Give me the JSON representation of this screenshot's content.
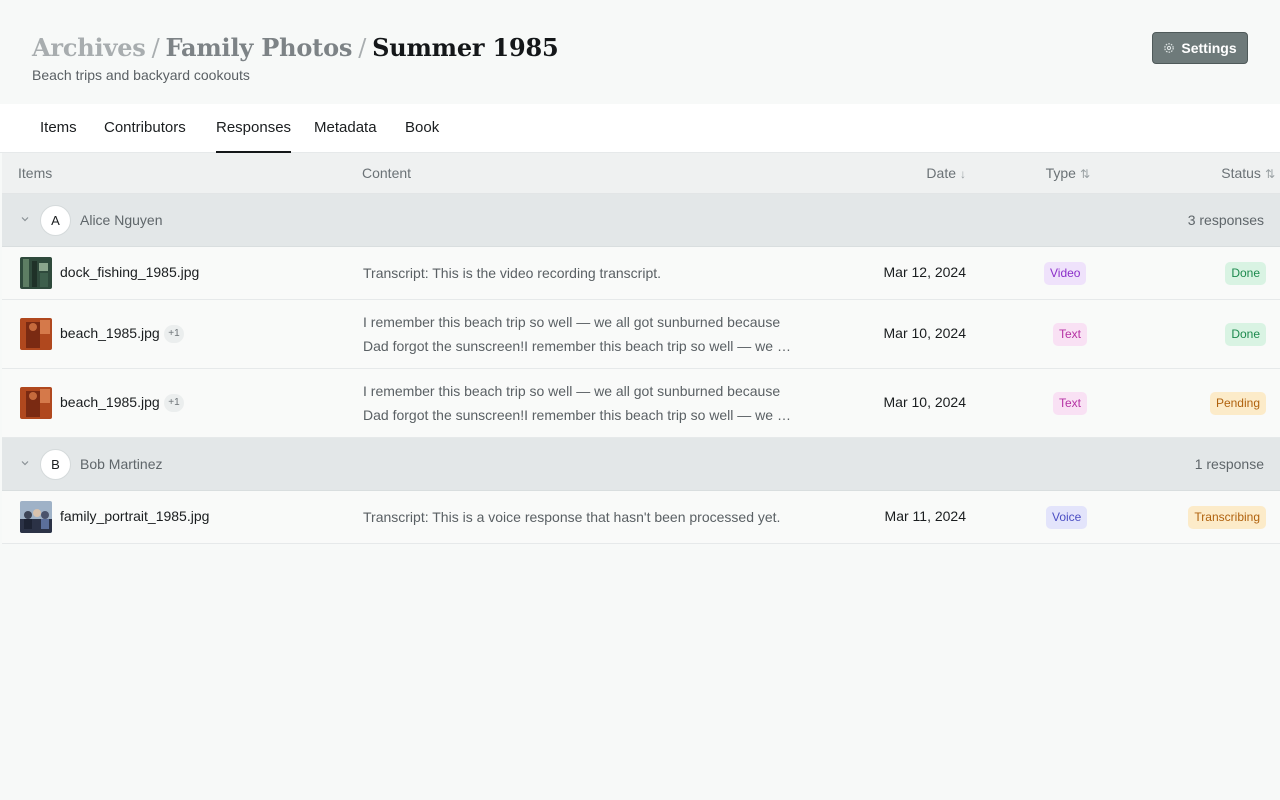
{
  "header": {
    "breadcrumb": [
      "Archives",
      "Family Photos",
      "Summer 1985"
    ],
    "separator": "/",
    "subtitle": "Beach trips and backyard cookouts",
    "settings_label": "Settings",
    "settings_icon": "gear-icon"
  },
  "tabs": [
    {
      "label": "Items"
    },
    {
      "label": "Contributors"
    },
    {
      "label": "Responses",
      "active": true
    },
    {
      "label": "Metadata"
    },
    {
      "label": "Book"
    }
  ],
  "table": {
    "columns": {
      "items": "Items",
      "content": "Content",
      "date": "Date",
      "date_sort": "↓",
      "type": "Type",
      "type_sort": "⇅",
      "status": "Status",
      "status_sort": "⇅"
    },
    "groups": [
      {
        "initial": "A",
        "name": "Alice Nguyen",
        "count": "3 responses",
        "rows": [
          {
            "file": "dock_fishing_1985.jpg",
            "extra": "",
            "content": [
              "Transcript: This is the video recording transcript."
            ],
            "date": "Mar 12, 2024",
            "type": "Video",
            "status": "Done"
          },
          {
            "file": "beach_1985.jpg",
            "extra": "+1",
            "content": [
              "I remember this beach trip so well — we all got sunburned because",
              "Dad forgot the sunscreen!I remember this beach trip so well — we all got sunburned"
            ],
            "date": "Mar 10, 2024",
            "type": "Text",
            "status": "Done"
          },
          {
            "file": "beach_1985.jpg",
            "extra": "+1",
            "content": [
              "I remember this beach trip so well — we all got sunburned because",
              "Dad forgot the sunscreen!I remember this beach trip so well — we all got sunburned"
            ],
            "date": "Mar 10, 2024",
            "type": "Text",
            "status": "Pending"
          }
        ]
      },
      {
        "initial": "B",
        "name": "Bob Martinez",
        "count": "1 response",
        "rows": [
          {
            "file": "family_portrait_1985.jpg",
            "extra": "",
            "content": [
              "Transcript: This is a voice response that hasn't been processed yet."
            ],
            "date": "Mar 11, 2024",
            "type": "Voice",
            "status": "Transcribing"
          }
        ]
      }
    ]
  },
  "colors": {
    "accent": "#6e7a7a",
    "done": "#1d8a4e",
    "pending": "#b0620e",
    "video": "#8b2fc9",
    "text": "#b532a4",
    "voice": "#4c4fc3"
  }
}
